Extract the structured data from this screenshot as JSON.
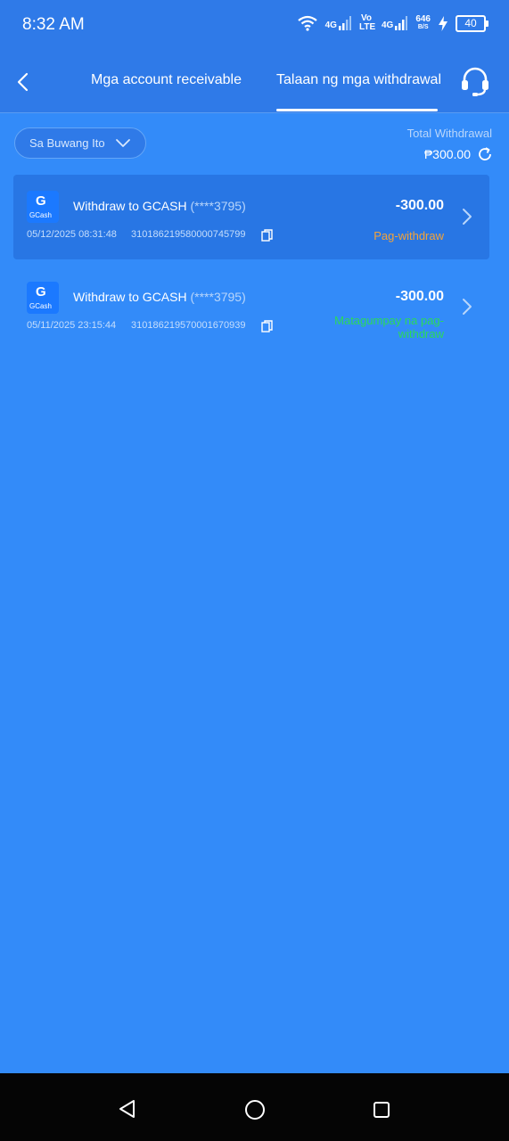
{
  "status_bar": {
    "time": "8:32 AM",
    "net1": "4G",
    "volte": "Vo LTE",
    "net2": "4G",
    "speed": "646",
    "speed_unit": "B/S",
    "battery": "40"
  },
  "header": {
    "tabs": [
      {
        "label": "Mga account receivable",
        "active": false
      },
      {
        "label": "Talaan ng mga withdrawal",
        "active": true
      }
    ]
  },
  "filter": {
    "selected": "Sa Buwang Ito"
  },
  "summary": {
    "label": "Total Withdrawal",
    "amount": "₱300.00"
  },
  "records": [
    {
      "icon": "gcash-logo",
      "logo_text": "GCash",
      "title": "Withdraw to GCASH",
      "account": "(****3795)",
      "amount": "-300.00",
      "datetime": "05/12/2025 08:31:48",
      "transaction_id": "310186219580000745799",
      "status": "Pag-withdraw",
      "status_color": "#f4a338"
    },
    {
      "icon": "gcash-logo",
      "logo_text": "GCash",
      "title": "Withdraw to GCASH",
      "account": "(****3795)",
      "amount": "-300.00",
      "datetime": "05/11/2025 23:15:44",
      "transaction_id": "310186219570001670939",
      "status": "Matagumpay na pag-withdraw",
      "status_color": "#2bd95a"
    }
  ],
  "colors": {
    "background": "#338bf9",
    "header": "#2f7ae8",
    "highlighted_card": "#2876e4"
  }
}
